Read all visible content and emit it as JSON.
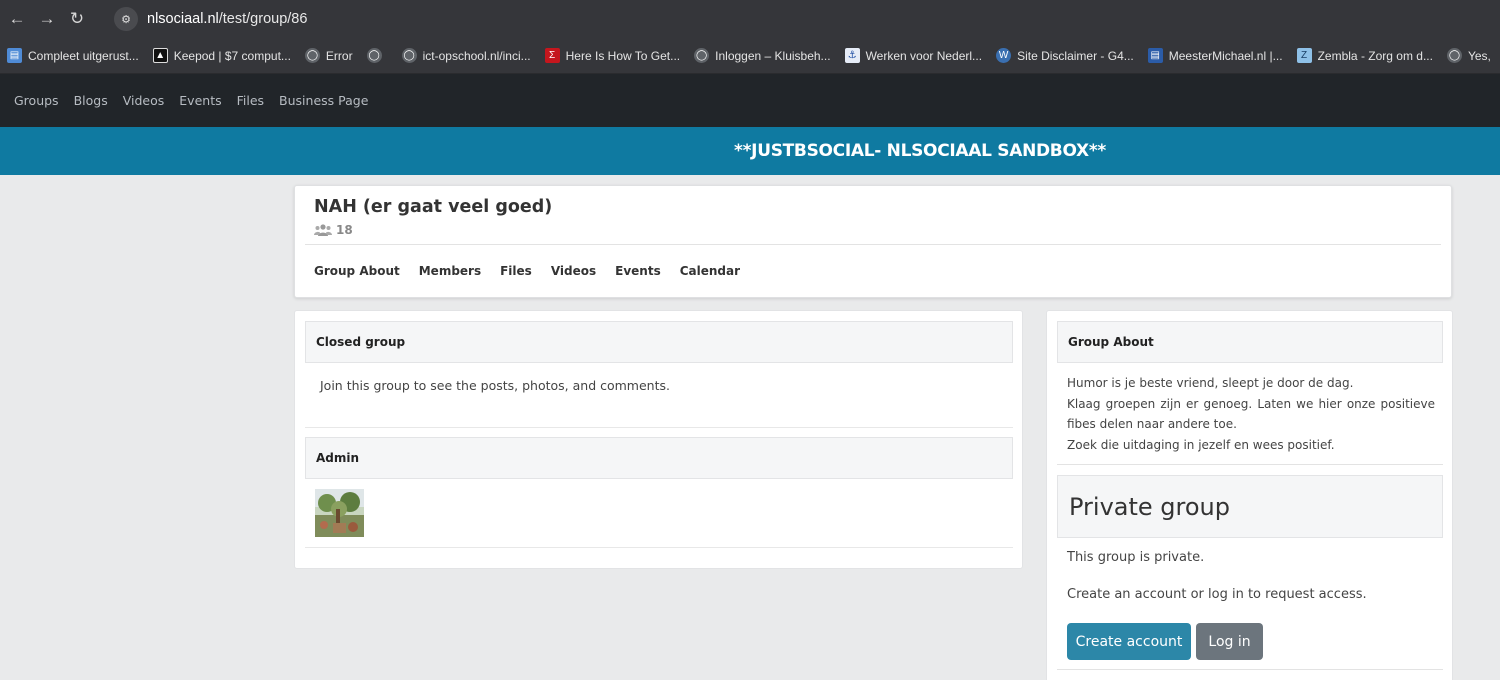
{
  "browser": {
    "url_host": "nlsociaal.nl",
    "url_path": "/test/group/86",
    "bookmarks": [
      {
        "label": "Compleet uitgerust...",
        "icon": "doc-icon"
      },
      {
        "label": "Keepod | $7 comput...",
        "icon": "keepod-icon"
      },
      {
        "label": "Error",
        "icon": "globe-icon"
      },
      {
        "label": "",
        "icon": "globe-icon"
      },
      {
        "label": "ict-opschool.nl/inci...",
        "icon": "globe-icon"
      },
      {
        "label": "Here Is How To Get...",
        "icon": "sigma-icon"
      },
      {
        "label": "Inloggen – Kluisbeh...",
        "icon": "globe-icon"
      },
      {
        "label": "Werken voor Nederl...",
        "icon": "nl-icon"
      },
      {
        "label": "Site Disclaimer - G4...",
        "icon": "wordpress-icon"
      },
      {
        "label": "MeesterMichael.nl |...",
        "icon": "mm-icon"
      },
      {
        "label": "Zembla - Zorg om d...",
        "icon": "zembla-icon"
      },
      {
        "label": "Yes, ",
        "icon": "globe-icon"
      }
    ]
  },
  "sitenav": {
    "items": [
      "Groups",
      "Blogs",
      "Videos",
      "Events",
      "Files",
      "Business Page"
    ]
  },
  "banner": {
    "title": "**JUSTBSOCIAL- NLSOCIAAL SANDBOX**"
  },
  "group": {
    "name": "NAH (er gaat veel goed)",
    "member_count": "18",
    "tabs": [
      "Group About",
      "Members",
      "Files",
      "Videos",
      "Events",
      "Calendar"
    ]
  },
  "left": {
    "closed_heading": "Closed group",
    "closed_text": "Join this group to see the posts, photos, and comments.",
    "admin_heading": "Admin"
  },
  "right": {
    "about_heading": "Group About",
    "about_lines": [
      "Humor is je beste vriend, sleept je door de dag.",
      "Klaag groepen zijn er genoeg. Laten we hier onze positieve fibes delen naar andere toe.",
      "Zoek die uitdaging in jezelf en wees positief."
    ],
    "private_heading": "Private group",
    "private_text": "This group is private.",
    "private_text2": "Create an account or log in to request access.",
    "create_label": "Create account",
    "login_label": "Log in"
  },
  "colors": {
    "banner": "#0f7aa1",
    "nav_bg": "#212529",
    "create_button": "#2c87a8",
    "login_button": "#6c757d"
  }
}
